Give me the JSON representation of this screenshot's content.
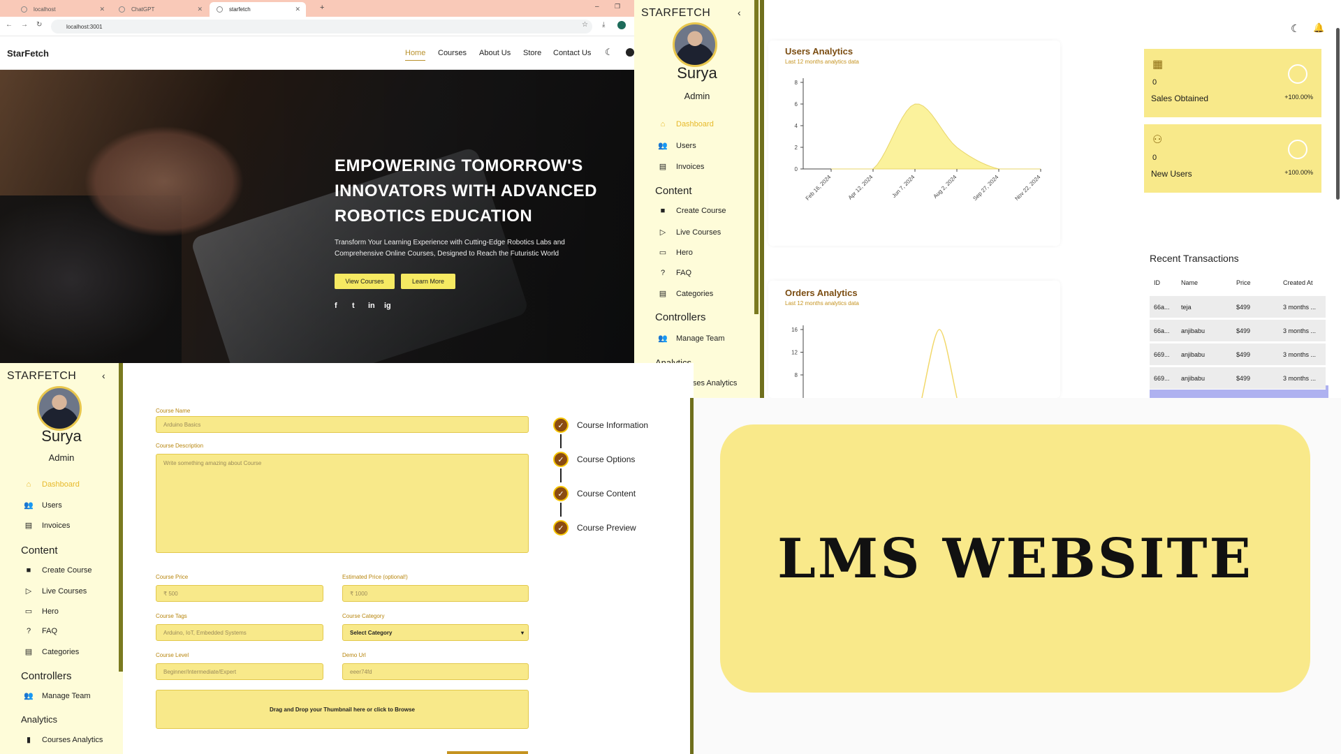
{
  "browser": {
    "tabs": [
      {
        "label": "localhost"
      },
      {
        "label": "ChatGPT"
      },
      {
        "label": "starfetch"
      }
    ],
    "url": "localhost:3001"
  },
  "website": {
    "brand": "StarFetch",
    "nav": [
      "Home",
      "Courses",
      "About Us",
      "Store",
      "Contact Us"
    ],
    "hero_title": "EMPOWERING TOMORROW'S INNOVATORS WITH ADVANCED ROBOTICS EDUCATION",
    "hero_text": "Transform Your Learning Experience with Cutting-Edge Robotics Labs and Comprehensive Online Courses, Designed to Reach the Futuristic World",
    "buttons": {
      "view": "View Courses",
      "learn": "Learn More"
    },
    "social": [
      "f",
      "t",
      "in",
      "ig"
    ]
  },
  "sidebar": {
    "title": "STARFETCH",
    "name": "Surya",
    "role": "Admin",
    "items": {
      "dashboard": "Dashboard",
      "users": "Users",
      "invoices": "Invoices",
      "content": "Content",
      "create": "Create Course",
      "live": "Live Courses",
      "hero": "Hero",
      "faq": "FAQ",
      "categories": "Categories",
      "controllers": "Controllers",
      "team": "Manage Team",
      "analytics": "Analytics",
      "course_analytics": "Courses Analytics"
    }
  },
  "dashboard": {
    "users_title": "Users Analytics",
    "users_sub": "Last 12 months analytics data",
    "orders_title": "Orders Analytics",
    "orders_sub": "Last 12 months analytics data",
    "stats": [
      {
        "value": "0",
        "label": "Sales Obtained",
        "pct": "+100.00%"
      },
      {
        "value": "0",
        "label": "New Users",
        "pct": "+100.00%"
      }
    ],
    "recent_title": "Recent Transactions",
    "table_headers": [
      "ID",
      "Name",
      "Price",
      "Created At"
    ],
    "rows": [
      {
        "id": "66a...",
        "name": "teja",
        "price": "$499",
        "created": "3 months ..."
      },
      {
        "id": "66a...",
        "name": "anjibabu",
        "price": "$499",
        "created": "3 months ..."
      },
      {
        "id": "669...",
        "name": "anjibabu",
        "price": "$499",
        "created": "3 months ..."
      },
      {
        "id": "669...",
        "name": "anjibabu",
        "price": "$499",
        "created": "3 months ..."
      }
    ]
  },
  "chart_data": [
    {
      "type": "area",
      "title": "Users Analytics",
      "x": [
        "Feb 16, 2024",
        "Apr 12, 2024",
        "Jun 7, 2024",
        "Aug 2, 2024",
        "Sep 27, 2024",
        "Nov 22, 2024"
      ],
      "series": [
        {
          "values": [
            0,
            0,
            6,
            2,
            0,
            0
          ]
        }
      ],
      "ylim": [
        0,
        8
      ],
      "yticks": [
        0,
        2,
        4,
        6,
        8
      ]
    },
    {
      "type": "line",
      "title": "Orders Analytics",
      "yticks": [
        8,
        12,
        16
      ],
      "ylim": [
        0,
        16
      ],
      "peak": 16
    }
  ],
  "form": {
    "labels": {
      "name": "Course Name",
      "desc": "Course Description",
      "price": "Course Price",
      "est": "Estimated Price (optional!)",
      "tags": "Course Tags",
      "cat": "Course Category",
      "level": "Course Level",
      "demo": "Demo Url"
    },
    "placeholders": {
      "name": "Arduino Basics",
      "desc": "Write something amazing about Course",
      "price": "₹ 500",
      "est": "₹ 1000",
      "tags": "Arduino, IoT, Embedded Systems",
      "cat": "Select Category",
      "level": "Beginner/Intermediate/Expert",
      "demo": "eeer74fd"
    },
    "upload": "Drag and Drop your Thumbnail here or click to Browse",
    "steps": [
      "Course Information",
      "Course Options",
      "Course Content",
      "Course Preview"
    ]
  },
  "banner": "LMS WEBSITE",
  "colors": {
    "accent": "#f8e98a",
    "sidebar": "#fefcd9",
    "brown": "#7b4d12"
  }
}
